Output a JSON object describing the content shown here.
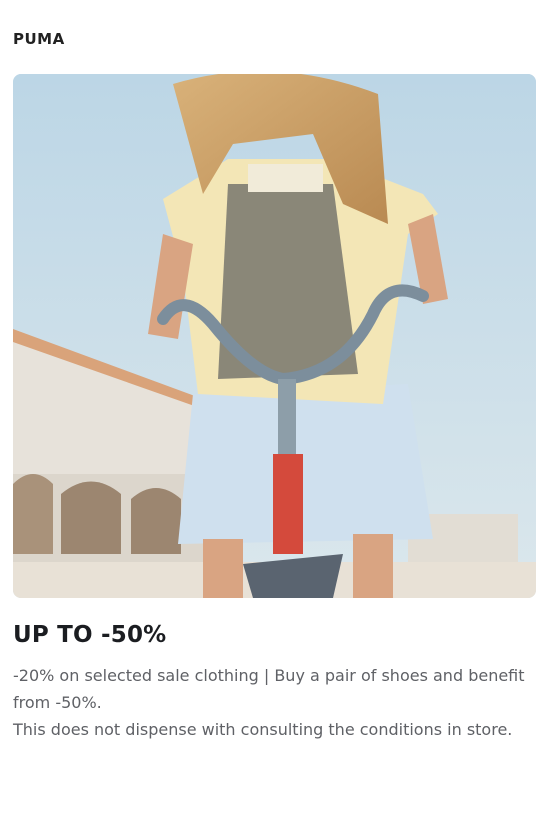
{
  "offer_card": {
    "brand": "PUMA",
    "hero_image": {
      "alt": "Girl in light yellow jacket riding a red bicycle",
      "icon": "promo-photo"
    },
    "headline": "UP TO -50%",
    "description_line_1": "-20% on selected sale clothing | Buy a pair of shoes and benefit from -50%.",
    "description_line_2": "This does not dispense with consulting the conditions in store."
  },
  "colors": {
    "headline": "#1b1d21",
    "body_text": "#5f6166",
    "sky": "#cfe0ea"
  }
}
